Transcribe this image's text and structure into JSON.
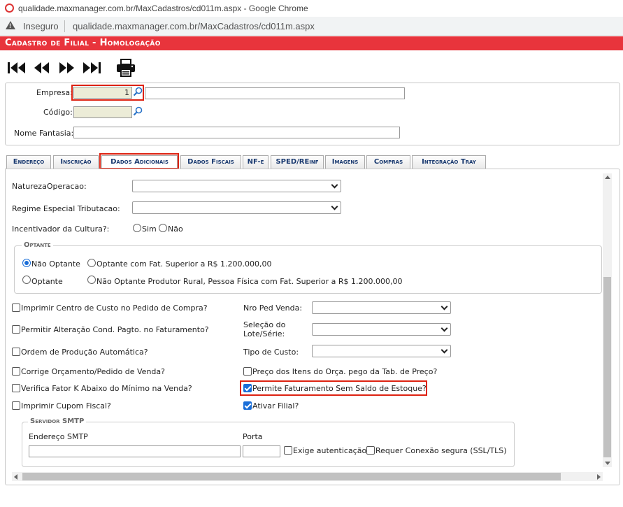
{
  "browser": {
    "window_title": "qualidade.maxmanager.com.br/MaxCadastros/cd011m.aspx - Google Chrome",
    "security_label": "Inseguro",
    "url": "qualidade.maxmanager.com.br/MaxCadastros/cd011m.aspx"
  },
  "header": {
    "title": "Cadastro de Filial  - Homologação"
  },
  "toolbar": {
    "icons": [
      "first-record-icon",
      "previous-record-icon",
      "next-record-icon",
      "last-record-icon",
      "print-icon"
    ]
  },
  "form_top": {
    "empresa_label": "Empresa:",
    "empresa_value": "1",
    "empresa_name_value": "",
    "codigo_label": "Código:",
    "codigo_value": "",
    "nome_fantasia_label": "Nome Fantasia:",
    "nome_fantasia_value": ""
  },
  "tabs": [
    {
      "label": "Endereço"
    },
    {
      "label": "Inscrição"
    },
    {
      "label": "Dados Adicionais"
    },
    {
      "label": "Dados Fiscais"
    },
    {
      "label": "NF-e"
    },
    {
      "label": "SPED/REinf"
    },
    {
      "label": "Imagens"
    },
    {
      "label": "Compras"
    },
    {
      "label": "Integração Tray"
    }
  ],
  "active_tab": "Dados Adicionais",
  "dados": {
    "natureza_label": "NaturezaOperacao:",
    "natureza_value": "",
    "regime_label": "Regime Especial Tributacao:",
    "regime_value": "",
    "incentivador_label": "Incentivador da Cultura?:",
    "sim_label": "Sim",
    "nao_label": "Não",
    "optante_legend": "Optante",
    "optante_options": [
      "Não Optante",
      "Optante com Fat. Superior a R$ 1.200.000,00",
      "Optante",
      "Não Optante Produtor Rural, Pessoa Física com Fat. Superior a R$ 1.200.000,00"
    ],
    "optante_selected": "Não Optante",
    "checkboxes_left": [
      {
        "label": "Imprimir Centro de Custo no Pedido de Compra?",
        "checked": false
      },
      {
        "label": "Permitir Alteração Cond. Pagto. no Faturamento?",
        "checked": false
      },
      {
        "label": "Ordem de Produção Automática?",
        "checked": false
      },
      {
        "label": "Corrige Orçamento/Pedido de Venda?",
        "checked": false
      },
      {
        "label": "Verifica Fator K Abaixo do Mínimo na Venda?",
        "checked": false
      },
      {
        "label": "Imprimir Cupom Fiscal?",
        "checked": false
      }
    ],
    "nro_ped_label": "Nro Ped Venda:",
    "selecao_label_1": "Seleção do",
    "selecao_label_2": "Lote/Série:",
    "tipo_custo_label": "Tipo de Custo:",
    "checkboxes_right": [
      {
        "label": "Preço dos Itens do Orça. pego da Tab. de Preço?",
        "checked": false
      },
      {
        "label": "Permite Faturamento Sem Saldo de Estoque?",
        "checked": true
      },
      {
        "label": "Ativar Filial?",
        "checked": true
      }
    ],
    "smtp_legend": "Servidor SMTP",
    "smtp_endereco_label": "Endereço SMTP",
    "smtp_porta_label": "Porta",
    "smtp_exige_label": "Exige autenticação",
    "smtp_requer_label": "Requer Conexão segura (SSL/TLS)"
  },
  "colors": {
    "header_red": "#e8343c",
    "highlight_red": "#d21",
    "tab_text": "#1a3a70",
    "check_blue": "#1a6ed8"
  }
}
